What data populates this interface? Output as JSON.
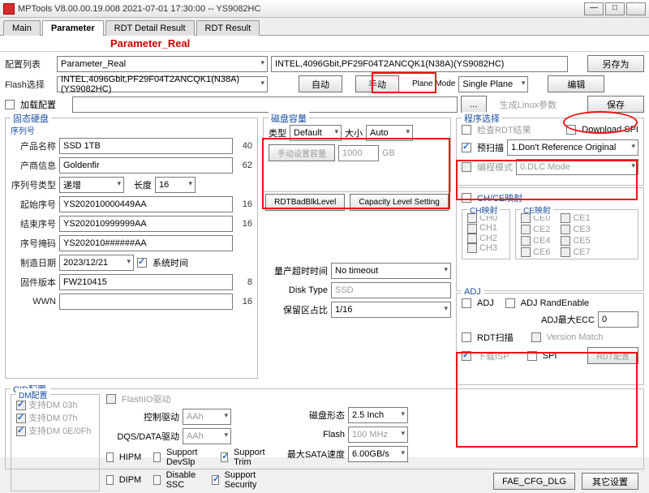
{
  "window": {
    "title": "MPTools V8.00.00.19.008 2021-07-01 17:30:00  -- YS9082HC",
    "min": "—",
    "max": "□",
    "close": "×"
  },
  "tabs": {
    "main": "Main",
    "param": "Parameter",
    "rdtdetail": "RDT Detail Result",
    "rdtresult": "RDT Result"
  },
  "hdr": {
    "title": "Parameter_Real"
  },
  "toprow": {
    "cfg_list_lbl": "配置列表",
    "cfg_sel": "Parameter_Real",
    "device": "INTEL,4096Gbit,PF29F04T2ANCQK1(N38A)(YS9082HC)",
    "saveas": "另存为"
  },
  "flashrow": {
    "lbl": "Flash选择",
    "sel": "INTEL,4096Gbit,PF29F04T2ANCQK1(N38A)(YS9082HC)",
    "auto": "自动",
    "manual": "手动",
    "planemode_lbl": "Plane Mode",
    "planemode_val": "Single Plane",
    "edit": "编辑"
  },
  "loadrow": {
    "chk": "加载配置",
    "dots": "...",
    "linux": "生成Linux参数",
    "save": "保存"
  },
  "ssd": {
    "legend": "固态硬盘",
    "serial_legend": "序列号",
    "prod_name_lbl": "产品名称",
    "prod_name": "SSD 1TB",
    "prod_name_n": "40",
    "vendor_lbl": "产商信息",
    "vendor": "Goldenfir",
    "vendor_n": "62",
    "sntype_lbl": "序列号类型",
    "sntype": "递增",
    "len_lbl": "长度",
    "len": "16",
    "start_lbl": "起始序号",
    "start": "YS202010000449AA",
    "start_n": "16",
    "end_lbl": "结束序号",
    "end": "YS202010999999AA",
    "end_n": "16",
    "mask_lbl": "序号掩码",
    "mask": "YS202010######AA",
    "mfg_lbl": "制造日期",
    "mfg": "2023/12/21",
    "systime": "系统时间",
    "fw_lbl": "固件版本",
    "fw": "FW210415",
    "fw_n": "8",
    "wwn_lbl": "WWN",
    "wwn": "",
    "wwn_n": "16"
  },
  "cap": {
    "legend": "磁盘容量",
    "type_lbl": "类型",
    "type": "Default",
    "size_lbl": "大小",
    "size": "Auto",
    "manualcap_lbl": "手动设置容量",
    "manualcap": "1000",
    "gb": "GB",
    "rdtbad": "RDTBadBlkLevel",
    "caplvl": "Capacity Level Setting"
  },
  "mp": {
    "timeout_lbl": "量产超时时间",
    "timeout": "No timeout",
    "disktype_lbl": "Disk Type",
    "disktype": "SSD",
    "reserve_lbl": "保留区占比",
    "reserve": "1/16"
  },
  "cid": {
    "legend": "CID配置",
    "dm_legend": "DM配置",
    "dm03h": "支持DM 03h",
    "dm07h": "支持DM 07h",
    "dm0e": "支持DM 0E/0Fh",
    "flashio": "FlashIO驱动",
    "ctrl_lbl": "控制驱动",
    "ctrl": "AAh",
    "dqs_lbl": "DQS/DATA驱动",
    "dqs": "AAh",
    "hipm": "HIPM",
    "devslp": "Support DevSlp",
    "trim": "Support Trim",
    "dipm": "DIPM",
    "ssc": "Disable SSC",
    "sec": "Support Security",
    "shape_lbl": "磁盘形态",
    "shape": "2.5 Inch",
    "flash_lbl": "Flash",
    "flash": "100 MHz",
    "sata_lbl": "最大SATA速度",
    "sata": "6.00GB/s"
  },
  "prog": {
    "legend": "程序选择",
    "chkrdt": "检查RDT结果",
    "dlspi": "Download SPI",
    "prescan": "预扫描",
    "prescan_val": "1.Don't Reference Original",
    "burn": "编程模式",
    "burn_val": "0.DLC Mode"
  },
  "chce": {
    "legend": "CH/CE映射",
    "ch_legend": "CH映射",
    "ce_legend": "CE映射",
    "ch0": "CH0",
    "ch1": "CH1",
    "ch2": "CH2",
    "ch3": "CH3",
    "ce0": "CE0",
    "ce1": "CE1",
    "ce2": "CE2",
    "ce3": "CE3",
    "ce4": "CE4",
    "ce5": "CE5",
    "ce6": "CE6",
    "ce7": "CE7"
  },
  "adj": {
    "legend": "ADJ",
    "adj": "ADJ",
    "rand": "ADJ RandEnable",
    "maxecc_lbl": "ADJ最大ECC",
    "maxecc": "0",
    "rdtscan": "RDT扫描",
    "ver": "Version Match",
    "dlisp": "下载ISP",
    "spi": "SPI",
    "rdtcfg": "RDT配置"
  },
  "bottom": {
    "fae": "FAE_CFG_DLG",
    "other": "其它设置"
  }
}
